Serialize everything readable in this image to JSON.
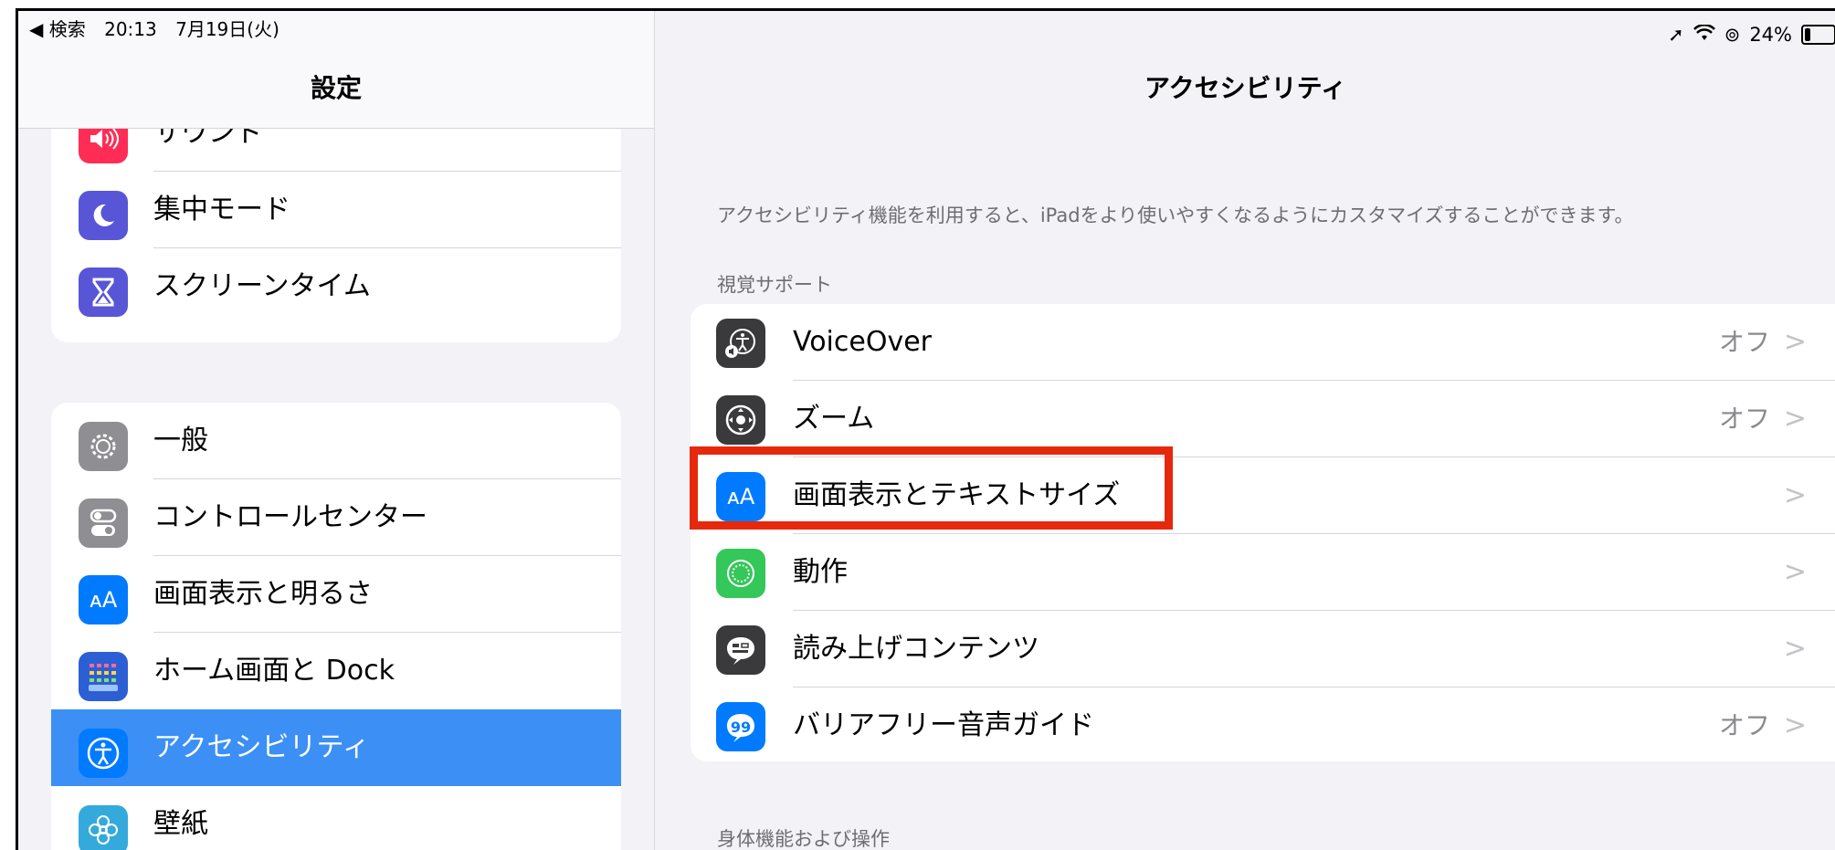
{
  "status": {
    "back_label": "◀ 検索",
    "time": "20:13",
    "date": "7月19日(火)",
    "battery": "24%"
  },
  "sidebar": {
    "title": "設定",
    "group1": [
      {
        "label": "サウンド",
        "icon": "speaker-icon",
        "color": "#ff2d55"
      },
      {
        "label": "集中モード",
        "icon": "moon-icon",
        "color": "#5856d6"
      },
      {
        "label": "スクリーンタイム",
        "icon": "hourglass-icon",
        "color": "#5856d6"
      }
    ],
    "group2": [
      {
        "label": "一般",
        "icon": "gear-icon",
        "color": "#8e8e93"
      },
      {
        "label": "コントロールセンター",
        "icon": "toggles-icon",
        "color": "#8e8e93"
      },
      {
        "label": "画面表示と明るさ",
        "icon": "text-size-icon",
        "color": "#007aff"
      },
      {
        "label": "ホーム画面と Dock",
        "icon": "home-grid-icon",
        "color": "#2d5fd4"
      },
      {
        "label": "アクセシビリティ",
        "icon": "accessibility-icon",
        "color": "#007aff",
        "selected": true
      },
      {
        "label": "壁紙",
        "icon": "flower-icon",
        "color": "#34aadc"
      }
    ]
  },
  "main": {
    "title": "アクセシビリティ",
    "description": "アクセシビリティ機能を利用すると、iPadをより使いやすくなるようにカスタマイズすることができます。",
    "section_vision": "視覚サポート",
    "section_physical": "身体機能および操作",
    "rows": [
      {
        "label": "VoiceOver",
        "value": "オフ",
        "icon": "voiceover-icon",
        "color": "#3a3a3c"
      },
      {
        "label": "ズーム",
        "value": "オフ",
        "icon": "zoom-icon",
        "color": "#3a3a3c"
      },
      {
        "label": "画面表示とテキストサイズ",
        "value": "",
        "icon": "text-size-icon",
        "color": "#007aff"
      },
      {
        "label": "動作",
        "value": "",
        "icon": "motion-icon",
        "color": "#34c759"
      },
      {
        "label": "読み上げコンテンツ",
        "value": "",
        "icon": "speech-bubble-icon",
        "color": "#3a3a3c"
      },
      {
        "label": "バリアフリー音声ガイド",
        "value": "オフ",
        "icon": "audio-description-icon",
        "color": "#007aff"
      }
    ]
  },
  "accent_colors": {
    "highlight": "#e6280c",
    "selected_row": "#3b8ff5"
  }
}
